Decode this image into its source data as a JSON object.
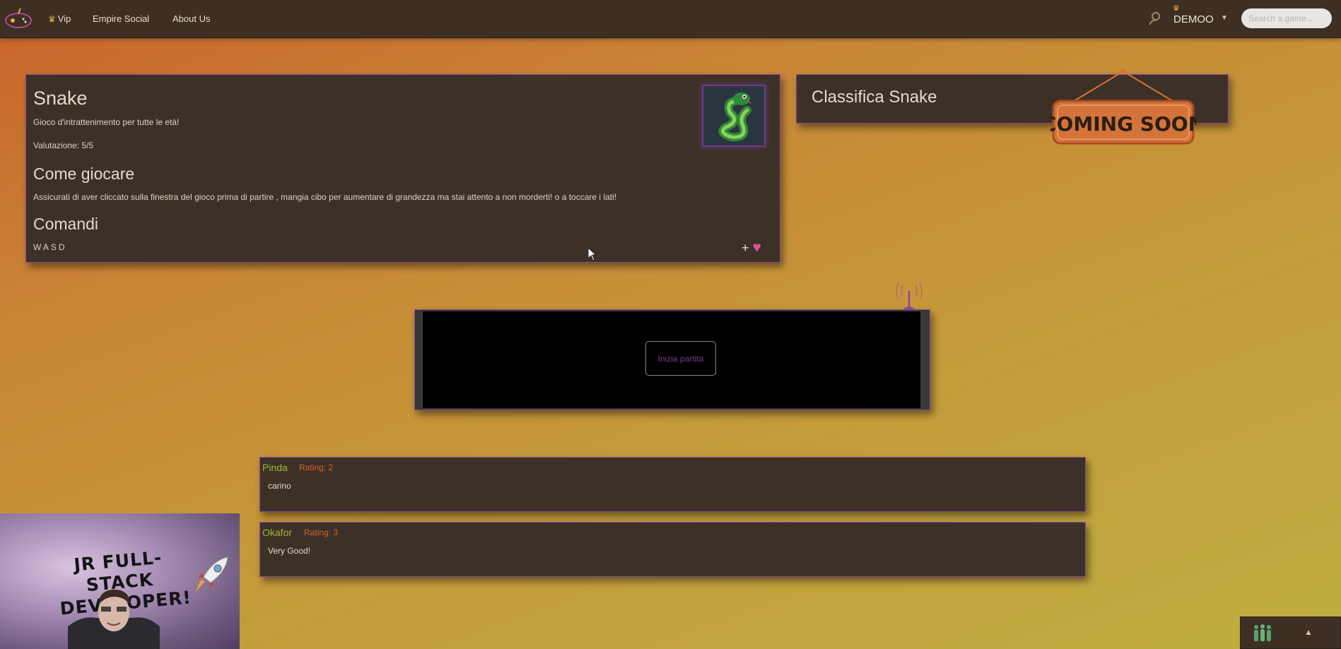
{
  "nav": {
    "vip": "Vip",
    "social": "Empire Social",
    "about": "About Us",
    "username": "DEMOO",
    "search_placeholder": "Search a game..."
  },
  "game": {
    "title": "Snake",
    "description": "Gioco d'intrattenimento per tutte le età!",
    "rating": "Valutazione: 5/5",
    "howto_heading": "Come giocare",
    "howto_text": "Assicurati di aver cliccato sulla finestra del gioco prima di partire , mangia cibo per aumentare di grandezza ma stai attento a non morderti! o a toccare i lati!",
    "commands_heading": "Comandi",
    "keys": "WASD",
    "fav_plus": "+",
    "fav_heart": "♥"
  },
  "leaderboard": {
    "title": "Classifica Snake",
    "badge": "COMING SOON"
  },
  "game_area": {
    "start_button": "Inizia partita"
  },
  "reviews": [
    {
      "author": "Pinda",
      "rating": "Rating: 2",
      "text": "carino"
    },
    {
      "author": "Okafor",
      "rating": "Rating: 3",
      "text": "Very Good!"
    }
  ],
  "overlay": {
    "webcam_title_line1": "JR FULL-STACK",
    "webcam_title_line2": "DEVELOPER!"
  },
  "colors": {
    "accent": "#8a4aa0",
    "panel_bg": "#3d3127",
    "navbar_bg": "#3e2f24",
    "review_author": "#9bbb35",
    "review_rating": "#d2622f"
  },
  "icons": [
    "gamepad-logo-icon",
    "crown-icon",
    "user-icon",
    "caret-down-icon",
    "snake-icon",
    "heart-icon",
    "antenna-icon",
    "rocket-icon",
    "chat-people-icon"
  ]
}
